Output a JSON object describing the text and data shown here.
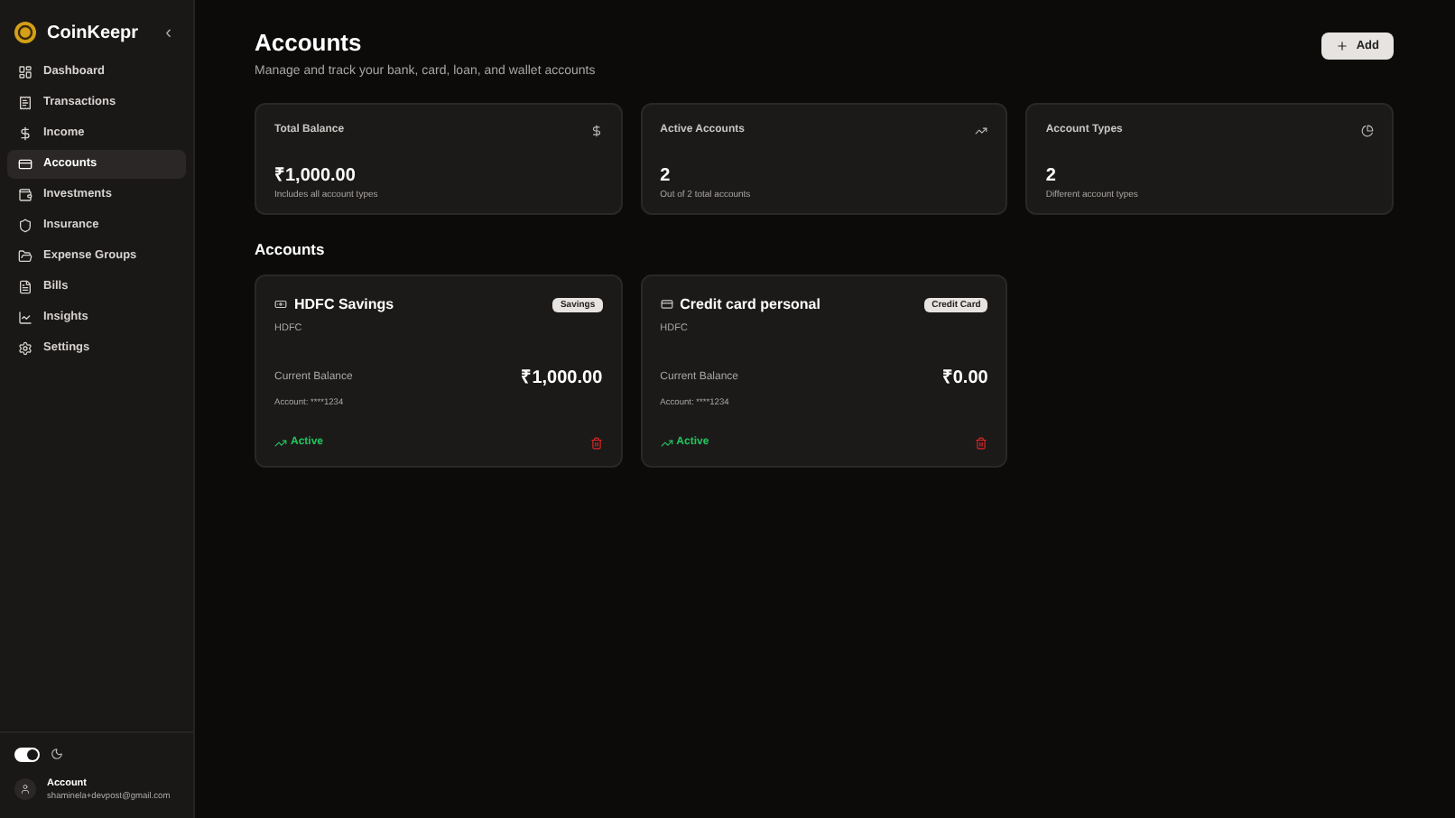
{
  "sidebar": {
    "brand": "CoinKeepr",
    "collapse": "‹",
    "items": [
      {
        "label": "Dashboard",
        "selected": false
      },
      {
        "label": "Transactions",
        "selected": false
      },
      {
        "label": "Income",
        "selected": false
      },
      {
        "label": "Accounts",
        "selected": true
      },
      {
        "label": "Investments",
        "selected": false
      },
      {
        "label": "Insurance",
        "selected": false
      },
      {
        "label": "Expense Groups",
        "selected": false
      },
      {
        "label": "Bills",
        "selected": false
      },
      {
        "label": "Insights",
        "selected": false
      },
      {
        "label": "Settings",
        "selected": false
      }
    ],
    "theme_toggle": {
      "on": true
    },
    "user": {
      "name": "Account",
      "email": "shaminela+devpost@gmail.com"
    }
  },
  "header": {
    "title": "Accounts",
    "subtitle": "Manage and track your bank, card, loan, and wallet accounts",
    "add_button": "Add"
  },
  "stats": [
    {
      "label": "Total Balance",
      "value": "₹1,000.00",
      "note": "Includes all account types"
    },
    {
      "label": "Active Accounts",
      "value": "2",
      "note": "Out of 2 total accounts"
    },
    {
      "label": "Account Types",
      "value": "2",
      "note": "Different account types"
    }
  ],
  "section_title": "Accounts",
  "accounts": [
    {
      "name": "HDFC Savings",
      "kind": "savings",
      "badge": "Savings",
      "bank": "HDFC",
      "balance_label": "Current Balance",
      "balance": "₹1,000.00",
      "number": "Account: ****1234",
      "status": "Active",
      "active": true
    },
    {
      "name": "Credit card personal",
      "kind": "card",
      "badge": "Credit Card",
      "bank": "HDFC",
      "balance_label": "Current Balance",
      "balance": "₹0.00",
      "number": "Account: ****1234",
      "status": "Active",
      "active": true
    }
  ]
}
